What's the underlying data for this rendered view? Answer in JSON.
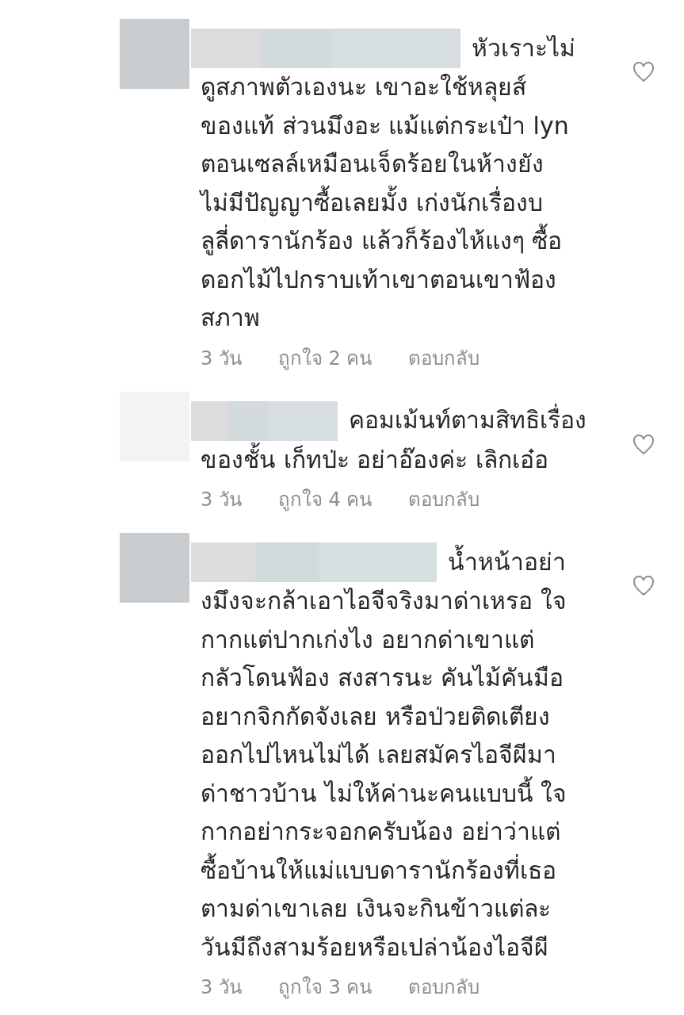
{
  "comments": [
    {
      "color": "#c8ccce",
      "first_line": "หัวเราะไม่",
      "text": "ดูสภาพตัวเองนะ เขาอะใช้หลุยส์\nของแท้ ส่วนมึงอะ แม้แต่กระเป๋า lyn\nตอนเซลล์เหมือนเจ็ดร้อยในห้างยัง\nไม่มีปัญญาซื้อเลยมั้ง เก่งนักเรื่องบ\nลูลี่ดารานักร้อง แล้วก็ร้องไห้แงๆ ซื้อ\nดอกไม้ไปกราบเท้าเขาตอนเขาฟ้อง\nสภาพ",
      "time": "3 วัน",
      "likes": "ถูกใจ 2 คน",
      "reply": "ตอบกลับ"
    },
    {
      "color": "#f3f3f3",
      "first_line": "คอมเม้นท์ตามสิทธิเรื่อง",
      "text": "ของชั้น เก็ทป่ะ อย่าอ๊องค่ะ เลิกเอ๋อ",
      "time": "3 วัน",
      "likes": "ถูกใจ 4 คน",
      "reply": "ตอบกลับ"
    },
    {
      "color": "#c8ccce",
      "first_line": "น้ำหน้าอย่า",
      "text": "งมึงจะกล้าเอาไอจีจริงมาด่าเหรอ ใจ\nกากแต่ปากเก่งไง อยากด่าเขาแต่\nกลัวโดนฟ้อง สงสารนะ คันไม้คันมือ\nอยากจิกกัดจังเลย หรือป่วยติดเตียง\nออกไปไหนไม่ได้ เลยสมัครไอจีผีมา\nด่าชาวบ้าน ไม่ให้ค่านะคนแบบนี้ ใจ\nกากอย่ากระจอกครับน้อง อย่าว่าแต่\nซื้อบ้านให้แม่แบบดารานักร้องที่เธอ\nตามด่าเขาเลย เงินจะกินข้าวแต่ละ\nวันมีถึงสามร้อยหรือเปล่าน้องไอจีผี",
      "time": "3 วัน",
      "likes": "ถูกใจ 3 คน",
      "reply": "ตอบกลับ"
    }
  ]
}
